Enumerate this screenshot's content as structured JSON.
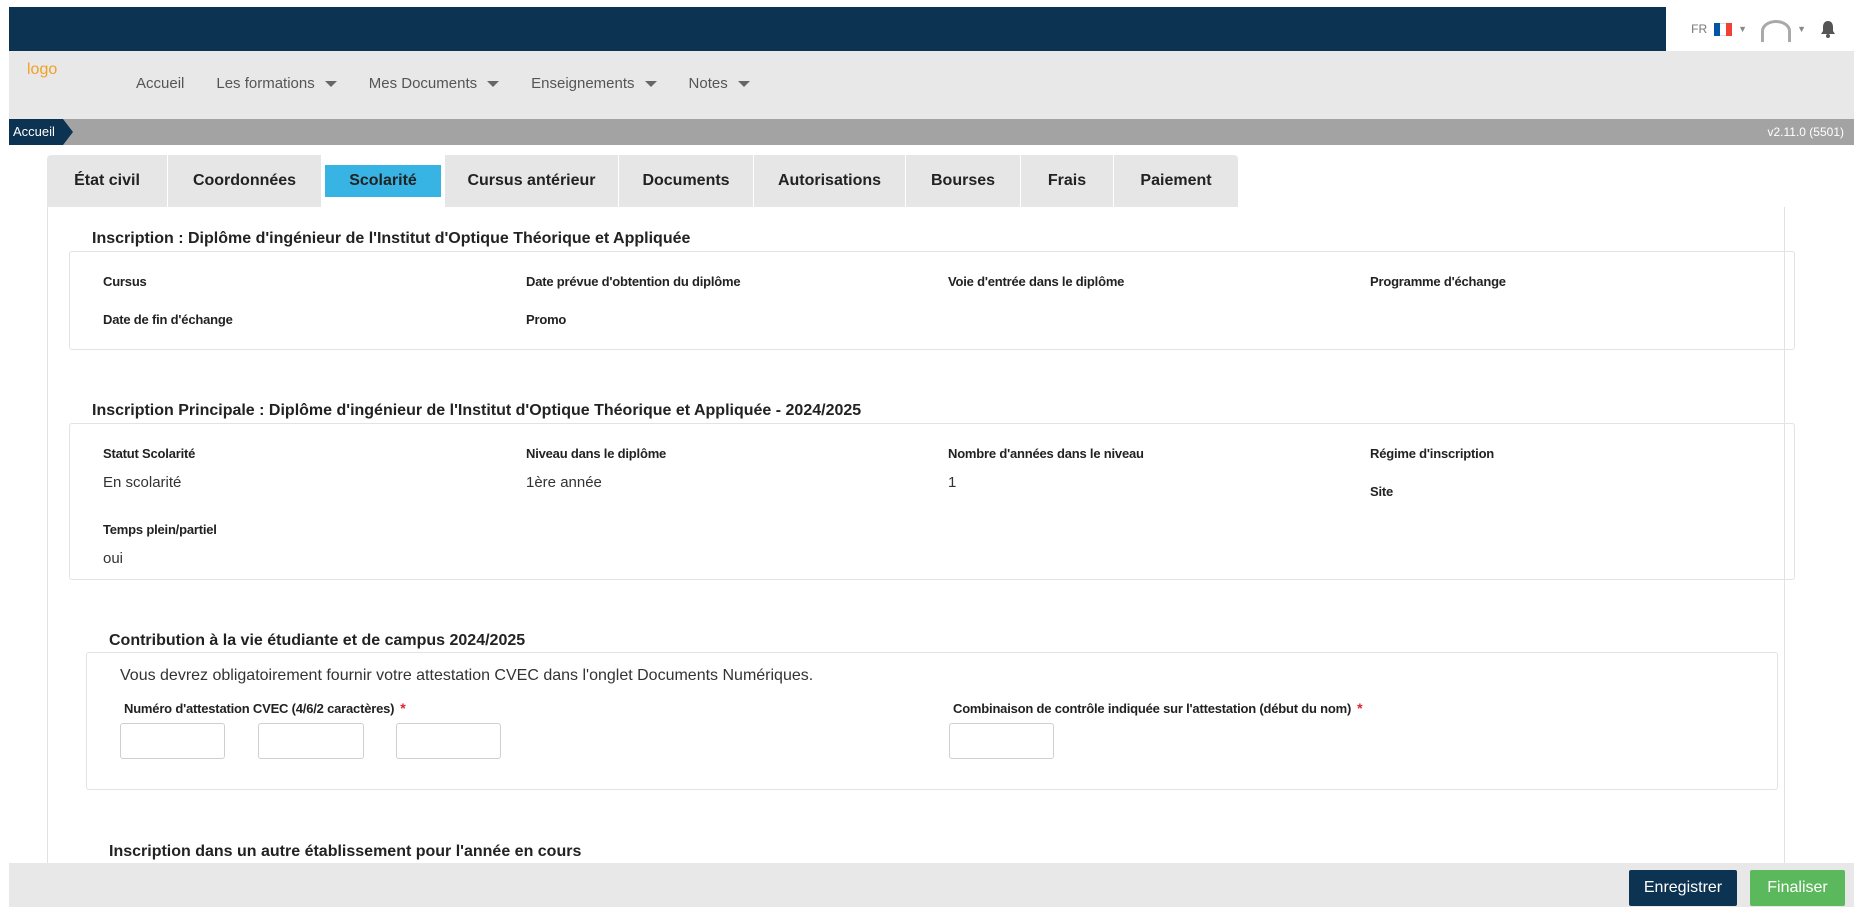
{
  "topbar": {
    "lang": "FR",
    "flag_colors": [
      "#0055a4",
      "#ffffff",
      "#ef4135"
    ],
    "avatar_icon": "user-icon",
    "bell_icon": "bell-icon"
  },
  "navbar": {
    "logo": "logo",
    "items": [
      {
        "label": "Accueil",
        "dropdown": false
      },
      {
        "label": "Les formations",
        "dropdown": true
      },
      {
        "label": "Mes Documents",
        "dropdown": true
      },
      {
        "label": "Enseignements",
        "dropdown": true
      },
      {
        "label": "Notes",
        "dropdown": true
      }
    ]
  },
  "breadcrumb": {
    "current": "Accueil",
    "version": "v2.11.0 (5501)"
  },
  "tabs": [
    {
      "label": "État civil",
      "active": false
    },
    {
      "label": "Coordonnées",
      "active": false
    },
    {
      "label": "Scolarité",
      "active": true
    },
    {
      "label": "Cursus antérieur",
      "active": false
    },
    {
      "label": "Documents",
      "active": false
    },
    {
      "label": "Autorisations",
      "active": false
    },
    {
      "label": "Bourses",
      "active": false
    },
    {
      "label": "Frais",
      "active": false
    },
    {
      "label": "Paiement",
      "active": false
    }
  ],
  "inscription": {
    "title": "Inscription : Diplôme d'ingénieur de l'Institut d'Optique Théorique et Appliquée",
    "fields": {
      "cursus": "Cursus",
      "date_prevue": "Date prévue d'obtention du diplôme",
      "voie_entree": "Voie d'entrée dans le diplôme",
      "programme_echange": "Programme d'échange",
      "date_fin_echange": "Date de fin d'échange",
      "promo": "Promo"
    }
  },
  "inscription_principale": {
    "title": "Inscription Principale : Diplôme d'ingénieur de l'Institut d'Optique Théorique et Appliquée - 2024/2025",
    "fields": {
      "statut_label": "Statut Scolarité",
      "statut_value": "En scolarité",
      "niveau_label": "Niveau dans le diplôme",
      "niveau_value": "1ère année",
      "nb_annees_label": "Nombre d'années dans le niveau",
      "nb_annees_value": "1",
      "regime_label": "Régime d'inscription",
      "site_label": "Site",
      "temps_label": "Temps plein/partiel",
      "temps_value": "oui"
    }
  },
  "cvec": {
    "title": "Contribution à la vie étudiante et de campus 2024/2025",
    "notice": "Vous devrez obligatoirement fournir votre attestation CVEC dans l'onglet Documents Numériques.",
    "numero_label": "Numéro d'attestation CVEC (4/6/2 caractères)",
    "combinaison_label": "Combinaison de contrôle indiquée sur l'attestation (début du nom)",
    "required_mark": "*"
  },
  "autre_etablissement": {
    "title": "Inscription dans un autre établissement pour l'année en cours"
  },
  "footer": {
    "save_label": "Enregistrer",
    "finish_label": "Finaliser"
  }
}
